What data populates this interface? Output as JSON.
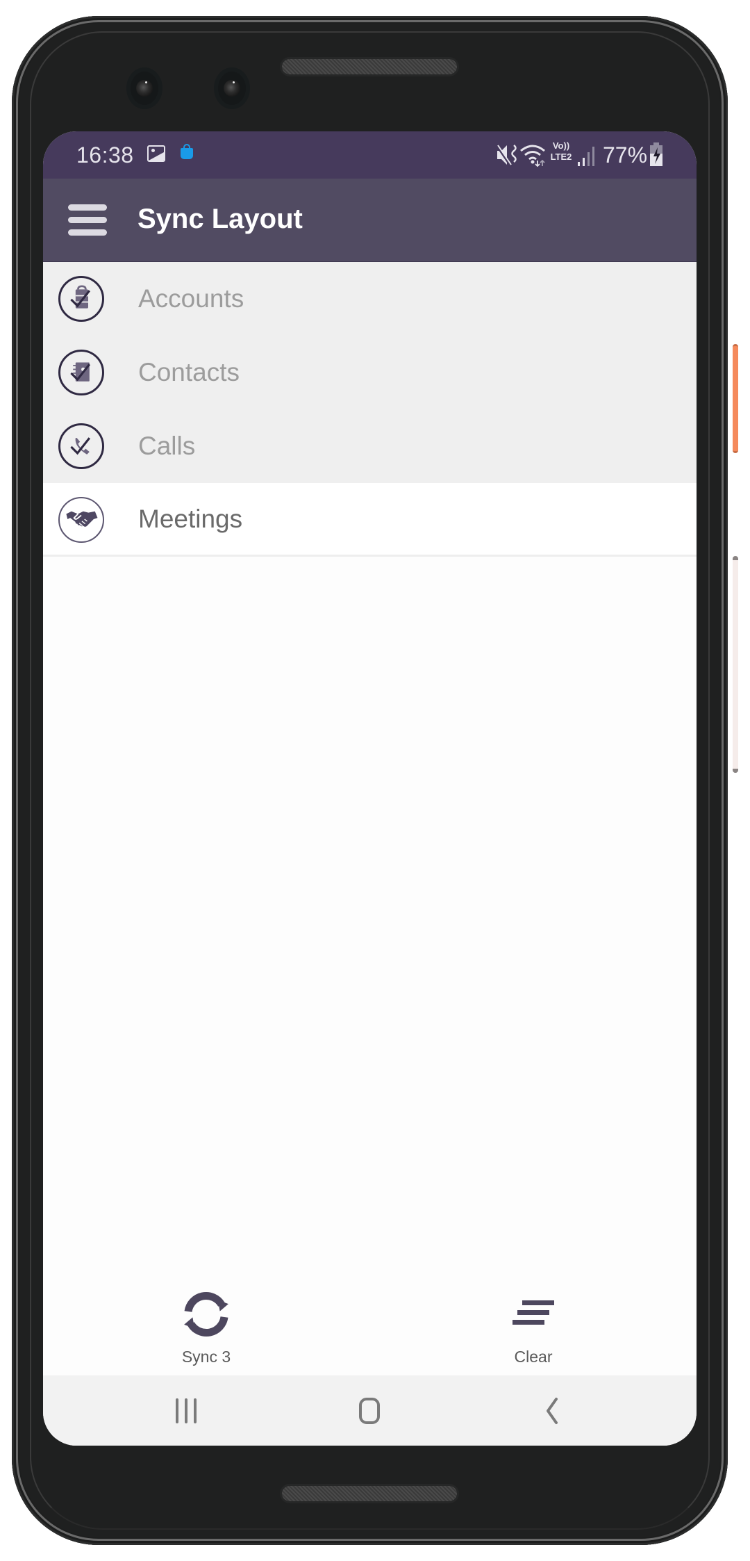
{
  "status_bar": {
    "time": "16:38",
    "left_icons": [
      "gallery-icon",
      "shopping-bag-icon"
    ],
    "right_icons": [
      "vibrate-icon",
      "wifi-icon",
      "volte-lte2-icon",
      "signal-icon",
      "battery-charging-icon"
    ],
    "volte_label_top": "Vo))",
    "volte_label_bottom": "LTE2",
    "battery_percent": "77%",
    "colors": {
      "background": "#463a5c",
      "bag_icon": "#1a9be8"
    }
  },
  "app_bar": {
    "menu_icon": "hamburger-menu-icon",
    "title": "Sync Layout",
    "background": "#514b62"
  },
  "list": {
    "items": [
      {
        "label": "Accounts",
        "icon": "accounts-check-icon",
        "state": "synced"
      },
      {
        "label": "Contacts",
        "icon": "contacts-check-icon",
        "state": "synced"
      },
      {
        "label": "Calls",
        "icon": "calls-check-icon",
        "state": "synced"
      },
      {
        "label": "Meetings",
        "icon": "handshake-icon",
        "state": "pending"
      }
    ]
  },
  "bottom_actions": {
    "sync": {
      "label": "Sync 3",
      "icon": "sync-icon"
    },
    "clear": {
      "label": "Clear",
      "icon": "clear-all-icon"
    }
  },
  "nav_bar": {
    "buttons": [
      "recents-icon",
      "home-icon",
      "back-icon"
    ]
  },
  "device": {
    "side_button_accent": "#f58a5c"
  }
}
